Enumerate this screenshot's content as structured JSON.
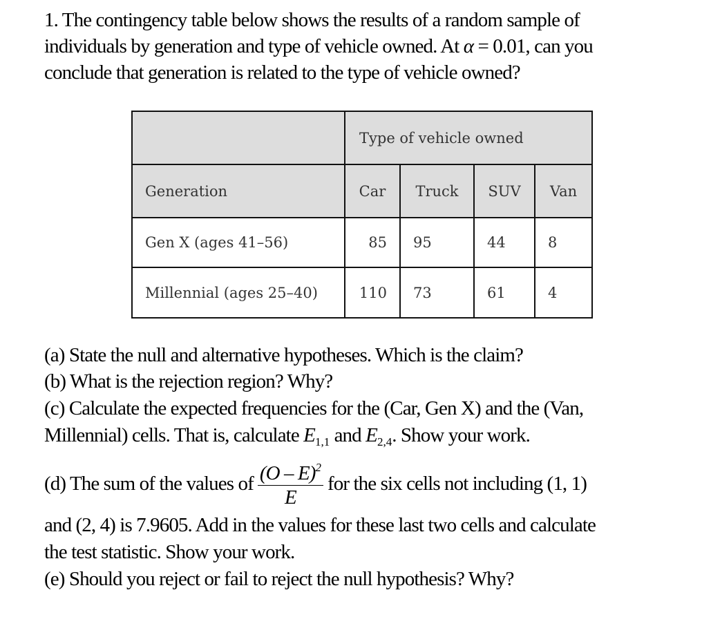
{
  "intro": {
    "line1": "1. The contingency table below shows the results of a random sample of",
    "line2_a": "individuals by generation and type of vehicle owned. At ",
    "alpha_symbol": "α",
    "alpha_eq": " = 0.01",
    "line2_b": ", can you",
    "line3": "conclude that generation is related to the type of vehicle owned?"
  },
  "table": {
    "group_header": "Type of vehicle owned",
    "row_header": "Generation",
    "columns": [
      "Car",
      "Truck",
      "SUV",
      "Van"
    ],
    "rows": [
      {
        "label": "Gen X (ages 41–56)",
        "values": [
          "85",
          "95",
          "44",
          "8"
        ]
      },
      {
        "label": "Millennial (ages 25–40)",
        "values": [
          "110",
          "73",
          "61",
          "4"
        ]
      }
    ]
  },
  "questions": {
    "a": "(a) State the null and alternative hypotheses. Which is the claim?",
    "b": "(b) What is the rejection region? Why?",
    "c_line1": "(c) Calculate the expected frequencies for the (Car, Gen X) and the (Van,",
    "c_line2_a": "Millennial) cells. That is, calculate ",
    "c_E": "E",
    "c_sub1": "1,1",
    "c_and": " and ",
    "c_sub2": "2,4",
    "c_line2_b": ". Show your work.",
    "d_line1_a": "(d) The sum of the values of",
    "d_frac_num": "(O – E)",
    "d_frac_sup": "2",
    "d_frac_den": "E",
    "d_line1_b": "for the six cells not including (1, 1)",
    "d_line2": "and (2, 4) is 7.9605. Add in the values for these last two cells and calculate",
    "d_line3": "the test statistic. Show your work.",
    "e": "(e) Should you reject or fail to reject the null hypothesis? Why?"
  }
}
